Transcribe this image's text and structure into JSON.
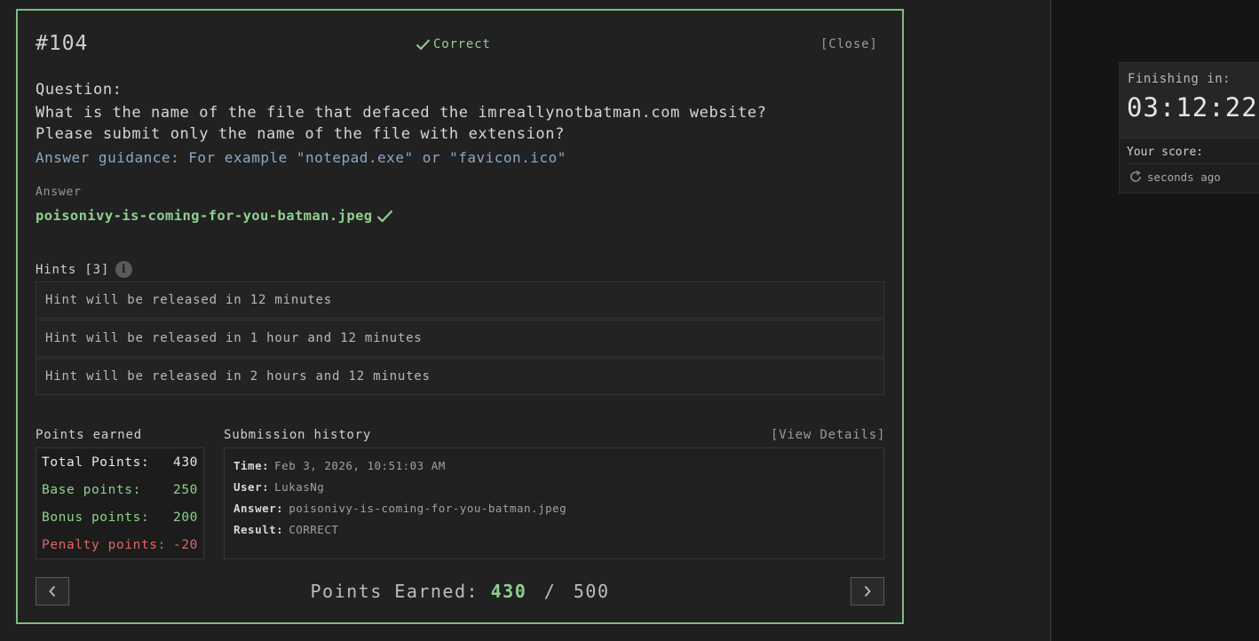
{
  "timer": {
    "finishing_label": "Finishing in:",
    "countdown": "03:12:22",
    "score_label": "Your score:",
    "updated": "seconds ago"
  },
  "question": {
    "number": "#104",
    "status": "Correct",
    "close_label": "[Close]",
    "label": "Question:",
    "text": "What is the name of the file that defaced the imreallynotbatman.com website?\nPlease submit only the name of the file with extension?",
    "guidance": "Answer guidance: For example \"notepad.exe\" or \"favicon.ico\""
  },
  "answer": {
    "label": "Answer",
    "value": "poisonivy-is-coming-for-you-batman.jpeg"
  },
  "hints": {
    "title": "Hints [3]",
    "items": [
      "Hint will be released in 12 minutes",
      "Hint will be released in 1 hour and 12 minutes",
      "Hint will be released in 2 hours and 12 minutes"
    ]
  },
  "points": {
    "title": "Points earned",
    "total_label": "Total Points:",
    "total": "430",
    "base_label": "Base points:",
    "base": "250",
    "bonus_label": "Bonus points:",
    "bonus": "200",
    "penalty_label": "Penalty points:",
    "penalty": "-20"
  },
  "submission": {
    "title": "Submission history",
    "details_label": "[View Details]",
    "time_label": "Time:",
    "time": "Feb 3, 2026, 10:51:03 AM",
    "user_label": "User:",
    "user": "LukasNg",
    "answer_label": "Answer:",
    "answer": "poisonivy-is-coming-for-you-batman.jpeg",
    "result_label": "Result:",
    "result": "CORRECT"
  },
  "footer": {
    "label": "Points Earned:",
    "earned": "430",
    "separator": "/",
    "max": "500"
  },
  "colors": {
    "accent_green": "#7dbd7d",
    "correct_text": "#8fcf8f",
    "penalty_red": "#e06565",
    "guidance_blue": "#8aa8c4"
  }
}
